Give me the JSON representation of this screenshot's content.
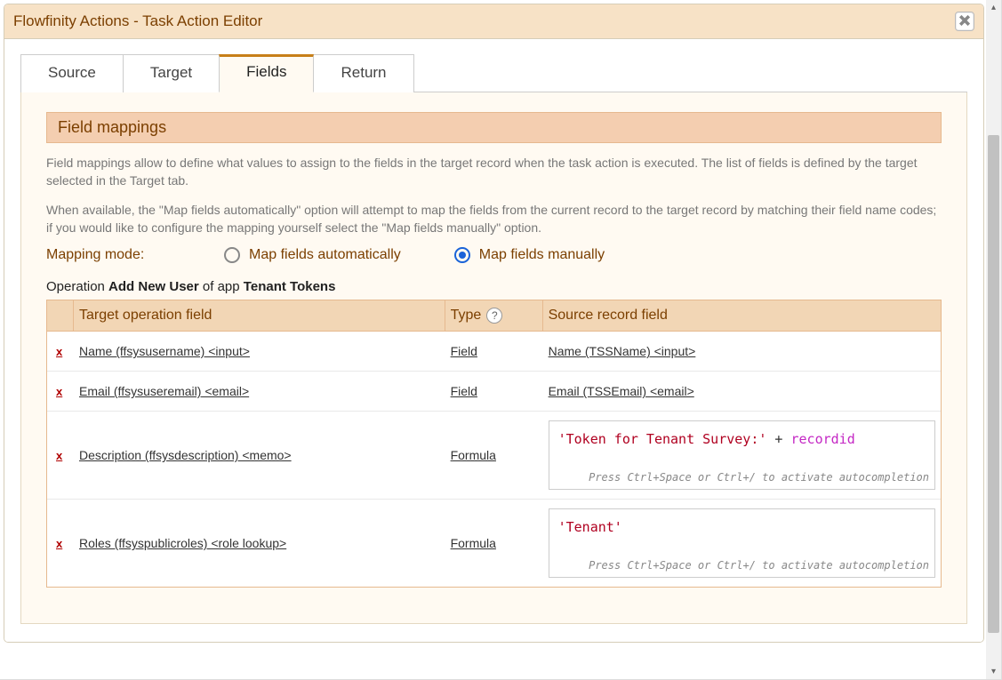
{
  "window": {
    "title": "Flowfinity Actions - Task Action Editor"
  },
  "tabs": [
    {
      "id": "source",
      "label": "Source",
      "active": false
    },
    {
      "id": "target",
      "label": "Target",
      "active": false
    },
    {
      "id": "fields",
      "label": "Fields",
      "active": true
    },
    {
      "id": "return",
      "label": "Return",
      "active": false
    }
  ],
  "section": {
    "heading": "Field mappings",
    "desc1": "Field mappings allow to define what values to assign to the fields in the target record when the task action is executed. The list of fields is defined by the target selected in the Target tab.",
    "desc2": "When available, the \"Map fields automatically\" option will attempt to map the fields from the current record to the target record by matching their field name codes; if you would like to configure the mapping yourself select the \"Map fields manually\" option."
  },
  "mapping_mode": {
    "label": "Mapping mode:",
    "options": [
      {
        "id": "auto",
        "label": "Map fields automatically",
        "selected": false
      },
      {
        "id": "manual",
        "label": "Map fields manually",
        "selected": true
      }
    ]
  },
  "operation": {
    "prefix": "Operation ",
    "name": "Add New User",
    "of_app": " of app ",
    "app": "Tenant Tokens"
  },
  "columns": {
    "target": "Target operation field",
    "type": "Type",
    "source": "Source record field"
  },
  "help_glyph": "?",
  "delete_glyph": "x",
  "formula_hint": "Press Ctrl+Space or Ctrl+/ to activate autocompletion",
  "rows": [
    {
      "target": "Name (ffsysusername) <input>",
      "type": "Field",
      "source_kind": "link",
      "source": "Name (TSSName) <input>"
    },
    {
      "target": "Email (ffsysuseremail) <email>",
      "type": "Field",
      "source_kind": "link",
      "source": "Email (TSSEmail) <email>"
    },
    {
      "target": "Description (ffsysdescription) <memo>",
      "type": "Formula",
      "source_kind": "formula",
      "formula_tokens": [
        {
          "cls": "str",
          "text": "'Token for Tenant Survey:'"
        },
        {
          "cls": "op",
          "text": " + "
        },
        {
          "cls": "var",
          "text": "recordid"
        }
      ]
    },
    {
      "target": "Roles (ffsyspublicroles) <role lookup>",
      "type": "Formula",
      "source_kind": "formula",
      "formula_tokens": [
        {
          "cls": "str",
          "text": "'Tenant'"
        }
      ]
    }
  ]
}
